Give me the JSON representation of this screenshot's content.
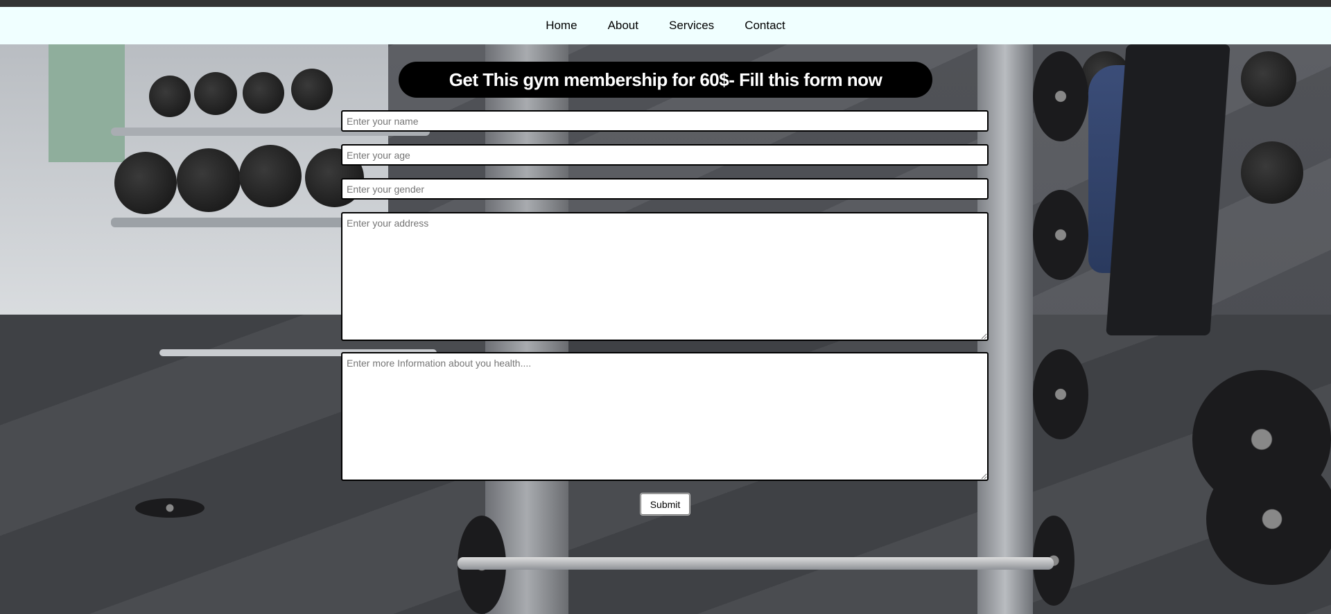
{
  "nav": {
    "items": [
      {
        "label": "Home"
      },
      {
        "label": "About"
      },
      {
        "label": "Services"
      },
      {
        "label": "Contact"
      }
    ]
  },
  "form": {
    "heading": "Get This gym membership for 60$- Fill this form now",
    "name_placeholder": "Enter your name",
    "age_placeholder": "Enter your age",
    "gender_placeholder": "Enter your gender",
    "address_placeholder": "Enter your address",
    "health_placeholder": "Enter more Information about you health....",
    "submit_label": "Submit"
  },
  "colors": {
    "nav_background": "#f0ffff",
    "top_strip": "#333333",
    "banner_background": "#000000",
    "banner_text": "#ffffff"
  }
}
